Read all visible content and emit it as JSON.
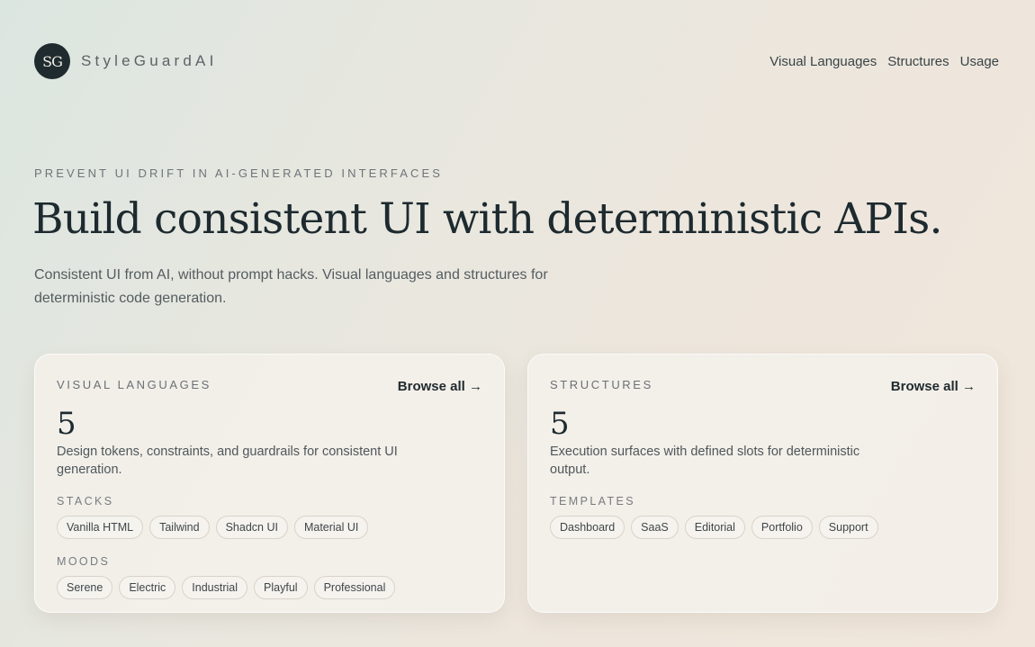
{
  "brand": {
    "logo_text": "SG",
    "name": "StyleGuardAI"
  },
  "nav": {
    "items": [
      "Visual Languages",
      "Structures",
      "Usage"
    ]
  },
  "hero": {
    "eyebrow": "PREVENT UI DRIFT IN AI-GENERATED INTERFACES",
    "headline": "Build consistent UI with deterministic APIs.",
    "subhead": "Consistent UI from AI, without prompt hacks. Visual languages and structures for deterministic code generation."
  },
  "cards": {
    "visual_languages": {
      "label": "VISUAL LANGUAGES",
      "browse": "Browse all →",
      "count": "5",
      "description": "Design tokens, constraints, and guardrails for consistent UI generation.",
      "stacks_label": "STACKS",
      "stacks": [
        "Vanilla HTML",
        "Tailwind",
        "Shadcn UI",
        "Material UI"
      ],
      "moods_label": "MOODS",
      "moods": [
        "Serene",
        "Electric",
        "Industrial",
        "Playful",
        "Professional"
      ]
    },
    "structures": {
      "label": "STRUCTURES",
      "browse": "Browse all →",
      "count": "5",
      "description": "Execution surfaces with defined slots for deterministic output.",
      "templates_label": "TEMPLATES",
      "templates": [
        "Dashboard",
        "SaaS",
        "Editorial",
        "Portfolio",
        "Support"
      ]
    }
  },
  "colors": {
    "logo_bg": "#1f2b2e",
    "heading": "#1d2a2f",
    "card_bg": "#f3f0e9"
  }
}
